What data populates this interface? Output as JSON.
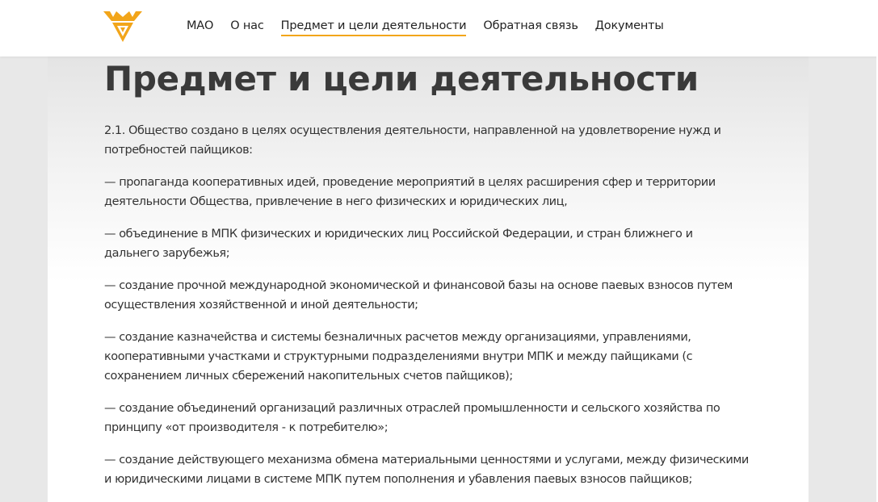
{
  "header": {
    "logo_icon": "triangle-logo-icon",
    "colors": {
      "accent": "#f2a51a",
      "header_bg": "#ffffff"
    }
  },
  "nav": {
    "items": [
      {
        "label": "МАО",
        "active": false
      },
      {
        "label": "О нас",
        "active": false
      },
      {
        "label": "Предмет и цели деятельности",
        "active": true
      },
      {
        "label": "Обратная связь",
        "active": false
      },
      {
        "label": "Документы",
        "active": false
      }
    ]
  },
  "main": {
    "title": "Предмет и цели деятельности",
    "paragraphs": [
      "2.1. Общество создано в целях осуществления деятельности, направленной на удовлетворение нужд и потребностей пайщиков:",
      "— пропаганда кооперативных идей, проведение мероприятий в целях расширения сфер и территории деятельности Общества, привлечение в него физических и юридических лиц,",
      "— объединение в МПК физических и юридических лиц Российской Федерации, и стран ближнего и дальнего зарубежья;",
      "— создание прочной международной экономической и финансовой базы на основе паевых взносов путем осуществления хозяйственной и иной деятельности;",
      "— создание казначейства и системы безналичных расчетов между организациями, управлениями, кооперативными участками и структурными подразделениями внутри МПК и между пайщиками (с сохранением личных сбережений накопительных счетов пайщиков);",
      "— создание объединений организаций различных отраслей промышленности и сельского хозяйства по принципу «от производителя - к потребителю»;",
      "— создание действующего механизма обмена материальными ценностями и услугами, между физическими и юридическими лицами в системе МПК путем пополнения и убавления паевых взносов пайщиков;"
    ]
  }
}
